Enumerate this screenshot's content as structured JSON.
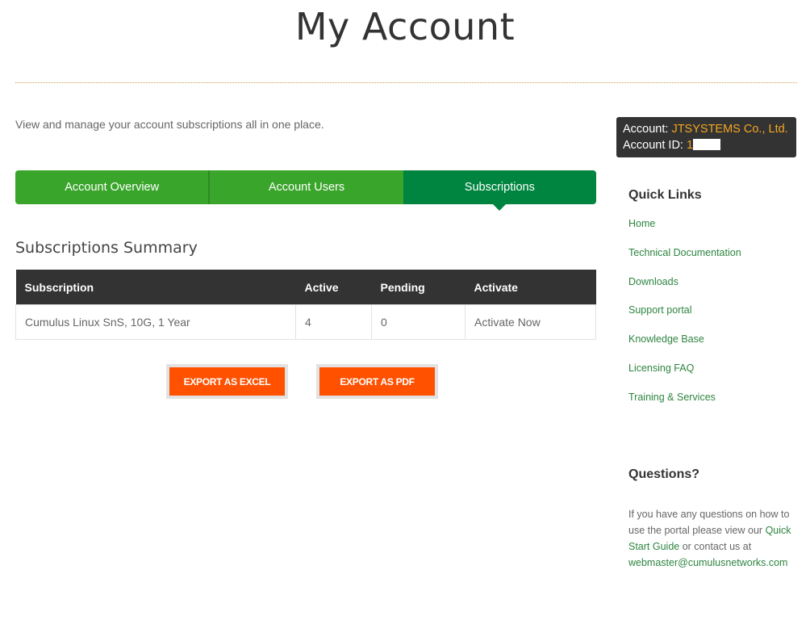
{
  "page": {
    "title": "My Account",
    "intro": "View and manage your account subscriptions all in one place."
  },
  "tabs": [
    {
      "label": "Account Overview",
      "active": false
    },
    {
      "label": "Account Users",
      "active": false
    },
    {
      "label": "Subscriptions",
      "active": true
    }
  ],
  "summary": {
    "title": "Subscriptions Summary",
    "columns": [
      "Subscription",
      "Active",
      "Pending",
      "Activate"
    ],
    "rows": [
      {
        "subscription": "Cumulus Linux SnS, 10G, 1 Year",
        "active": "4",
        "pending": "0",
        "activate": "Activate Now"
      }
    ]
  },
  "exports": {
    "excel_label": "EXPORT AS EXCEL",
    "pdf_label": "EXPORT AS PDF"
  },
  "account": {
    "account_label": "Account:",
    "account_name": "JTSYSTEMS Co., Ltd.",
    "id_label": "Account ID:",
    "id_value": "1"
  },
  "quick_links": {
    "title": "Quick Links",
    "items": [
      "Home",
      "Technical Documentation",
      "Downloads",
      "Support portal",
      "Knowledge Base",
      "Licensing FAQ",
      "Training & Services"
    ]
  },
  "questions": {
    "title": "Questions?",
    "text_before": "If you have any questions on how to use the portal please view our",
    "guide_link": "Quick Start Guide",
    "text_middle": "or contact us at",
    "email": "webmaster@cumulusnetworks.com"
  },
  "colors": {
    "tab_green": "#3aa52b",
    "tab_active": "#008540",
    "export_orange": "#ff5100",
    "link_green": "#2e8540",
    "highlight_orange": "#f5a623"
  }
}
